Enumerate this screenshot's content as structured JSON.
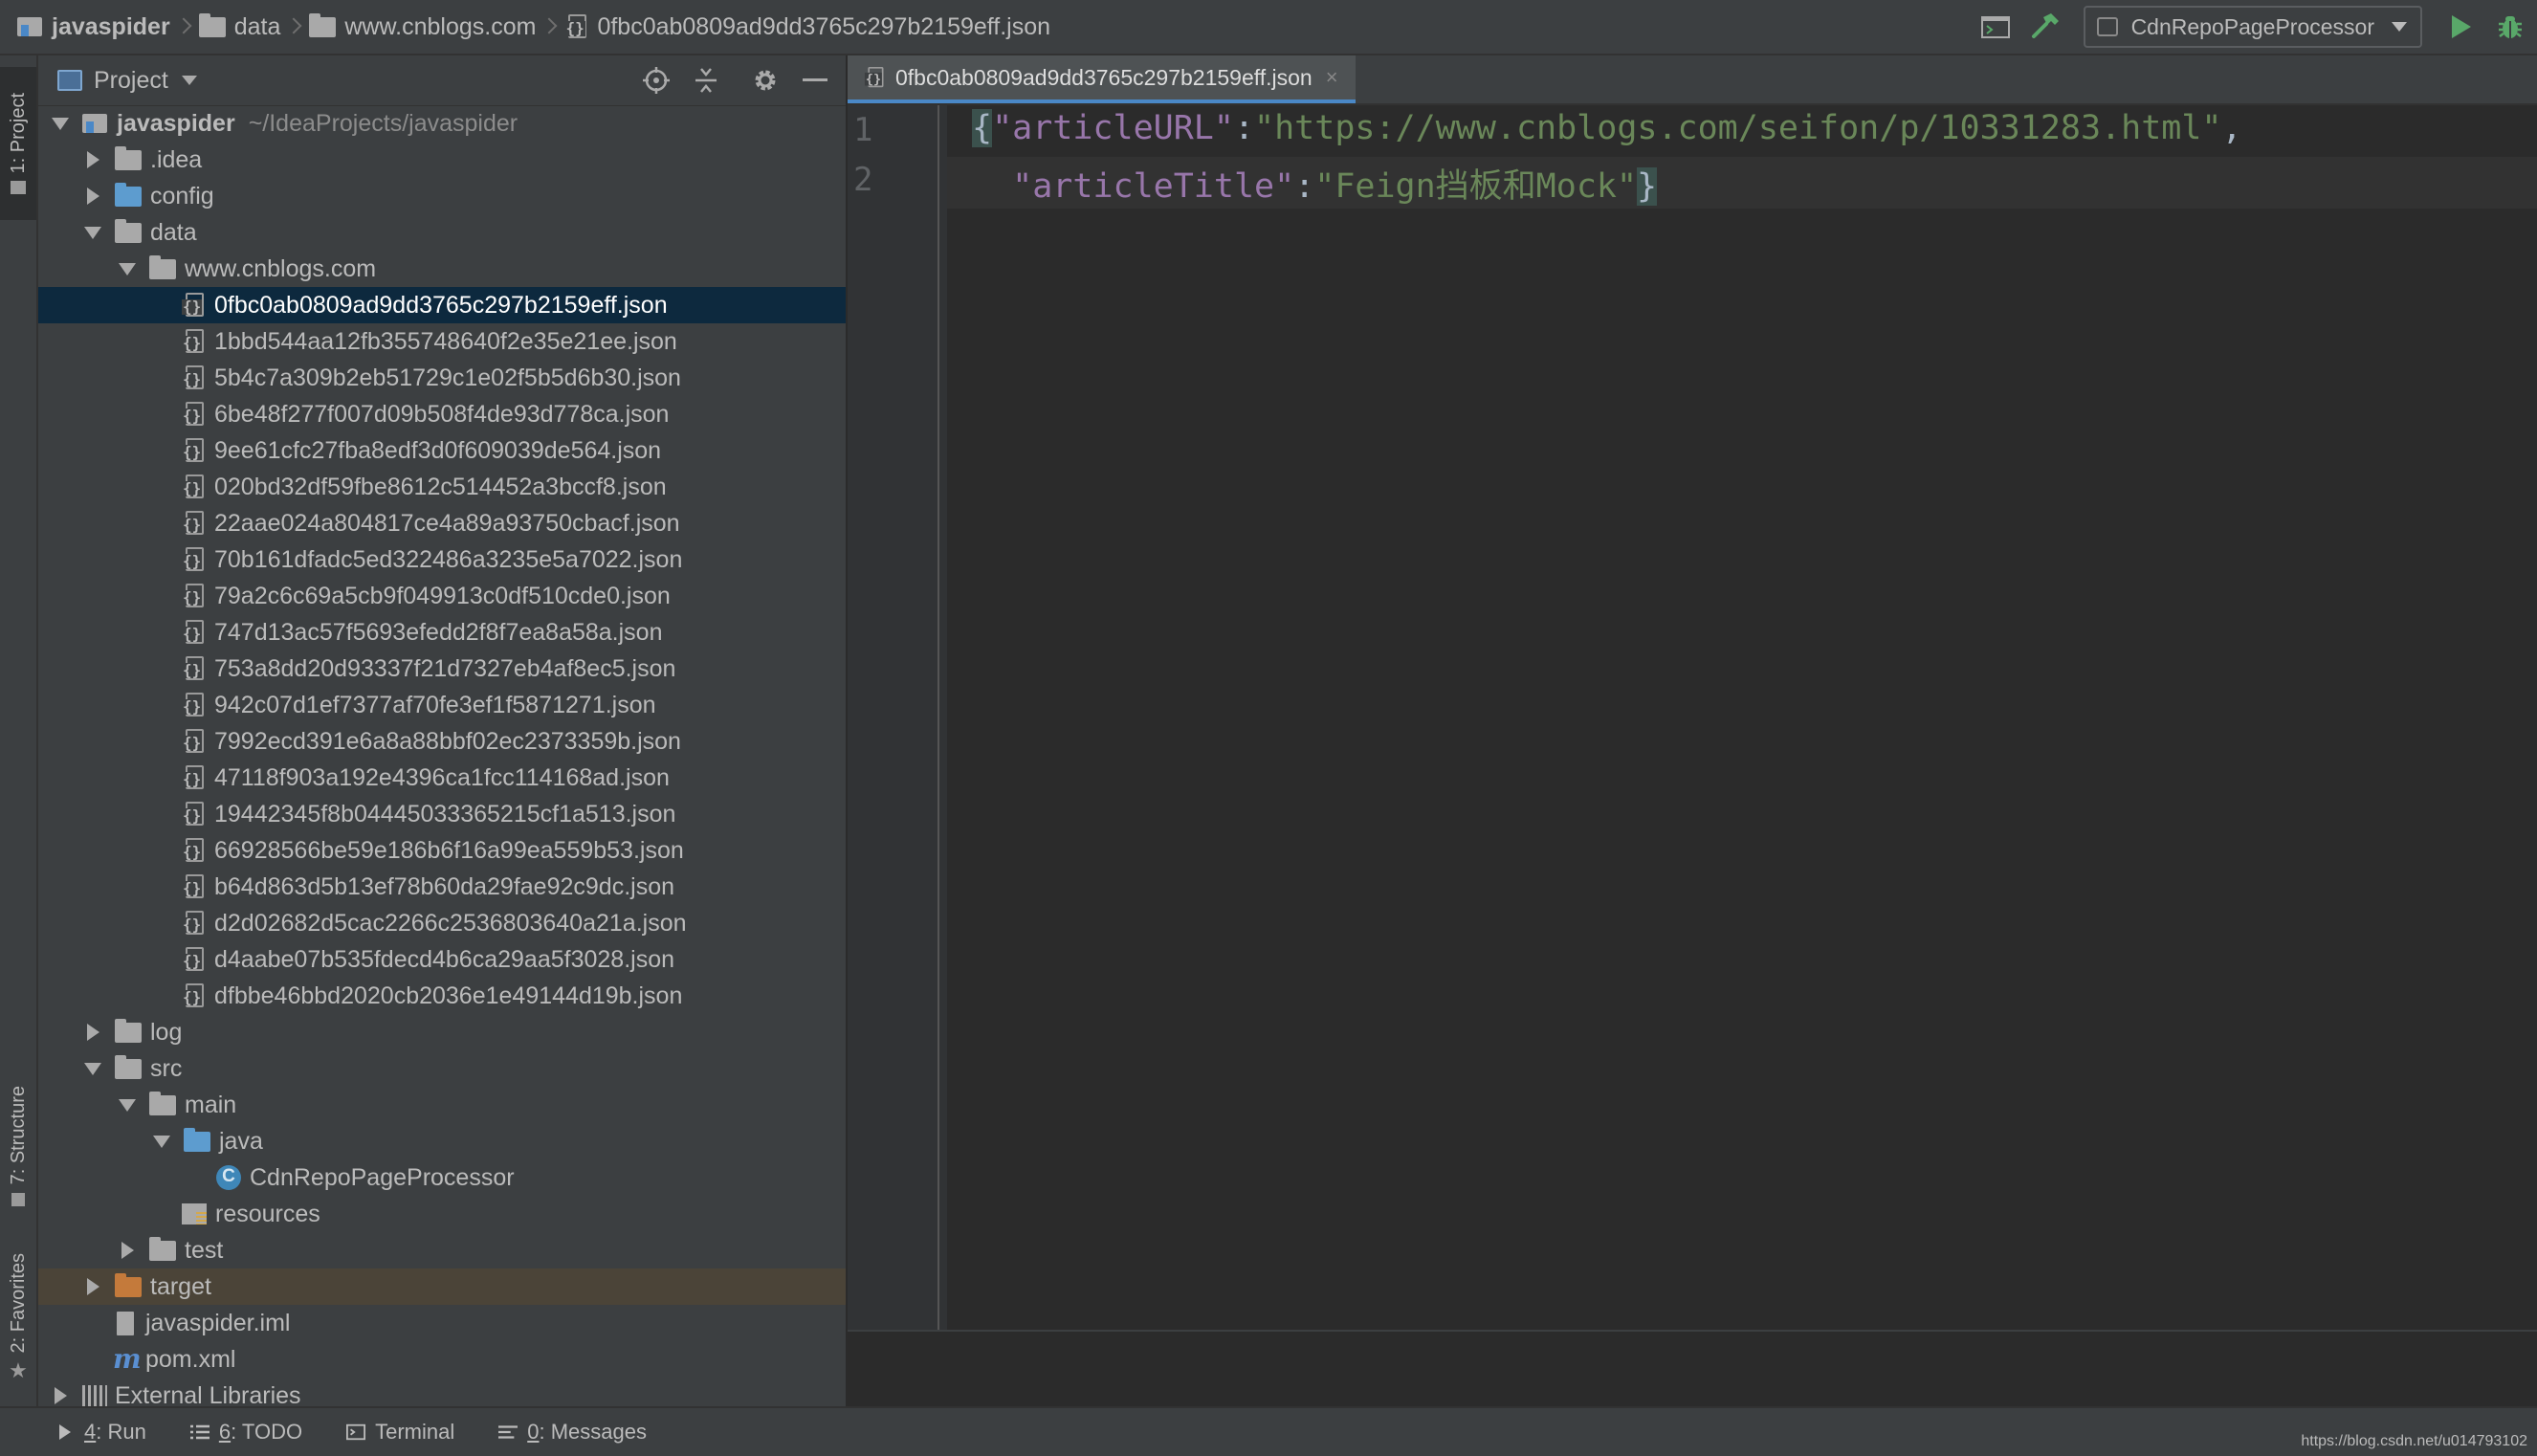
{
  "breadcrumbs": [
    {
      "label": "javaspider",
      "icon": "project-icon"
    },
    {
      "label": "data",
      "icon": "folder-icon"
    },
    {
      "label": "www.cnblogs.com",
      "icon": "folder-icon"
    },
    {
      "label": "0fbc0ab0809ad9dd3765c297b2159eff.json",
      "icon": "json-file-icon"
    }
  ],
  "toolbar": {
    "run_config": "CdnRepoPageProcessor"
  },
  "left_stripe": {
    "project_tab": "1: Project",
    "structure_tab": "7: Structure",
    "favorites_tab": "2: Favorites"
  },
  "project_panel": {
    "title": "Project",
    "root_name": "javaspider",
    "root_path": "~/IdeaProjects/javaspider",
    "items": {
      "idea": ".idea",
      "config": "config",
      "data": "data",
      "cnblogs": "www.cnblogs.com",
      "log": "log",
      "src": "src",
      "main": "main",
      "java": "java",
      "processor": "CdnRepoPageProcessor",
      "resources": "resources",
      "test": "test",
      "target": "target",
      "iml": "javaspider.iml",
      "pom": "pom.xml",
      "libs": "External Libraries"
    },
    "json_files": [
      "0fbc0ab0809ad9dd3765c297b2159eff.json",
      "1bbd544aa12fb355748640f2e35e21ee.json",
      "5b4c7a309b2eb51729c1e02f5b5d6b30.json",
      "6be48f277f007d09b508f4de93d778ca.json",
      "9ee61cfc27fba8edf3d0f609039de564.json",
      "020bd32df59fbe8612c514452a3bccf8.json",
      "22aae024a804817ce4a89a93750cbacf.json",
      "70b161dfadc5ed322486a3235e5a7022.json",
      "79a2c6c69a5cb9f049913c0df510cde0.json",
      "747d13ac57f5693efedd2f8f7ea8a58a.json",
      "753a8dd20d93337f21d7327eb4af8ec5.json",
      "942c07d1ef7377af70fe3ef1f5871271.json",
      "7992ecd391e6a8a88bbf02ec2373359b.json",
      "47118f903a192e4396ca1fcc114168ad.json",
      "19442345f8b04445033365215cf1a513.json",
      "66928566be59e186b6f16a99ea559b53.json",
      "b64d863d5b13ef78b60da29fae92c9dc.json",
      "d2d02682d5cac2266c2536803640a21a.json",
      "d4aabe07b535fdecd4b6ca29aa5f3028.json",
      "dfbbe46bbd2020cb2036e1e49144d19b.json"
    ]
  },
  "editor": {
    "tab_label": "0fbc0ab0809ad9dd3765c297b2159eff.json",
    "line_numbers": [
      "1",
      "2"
    ],
    "line1": {
      "open_brace": "{",
      "key": "\"articleURL\"",
      "colon": ":",
      "value": "\"https://www.cnblogs.com/seifon/p/10331283.html\"",
      "comma": ","
    },
    "line2": {
      "indent": "  ",
      "key": "\"articleTitle\"",
      "colon": ":",
      "value": "\"Feign挡板和Mock\"",
      "close_brace": "}"
    }
  },
  "bottom_tools": {
    "run_key": "4",
    "run_label": ": Run",
    "todo_key": "6",
    "todo_label": ": TODO",
    "terminal_label": "Terminal",
    "messages_key": "0",
    "messages_label": ": Messages"
  },
  "watermark": "https://blog.csdn.net/u014793102",
  "colors": {
    "background": "#2b2b2b",
    "panel": "#3c3f41",
    "selection": "#0d293e",
    "json_key": "#9876aa",
    "json_string": "#6a8759",
    "run_green": "#59a869"
  }
}
